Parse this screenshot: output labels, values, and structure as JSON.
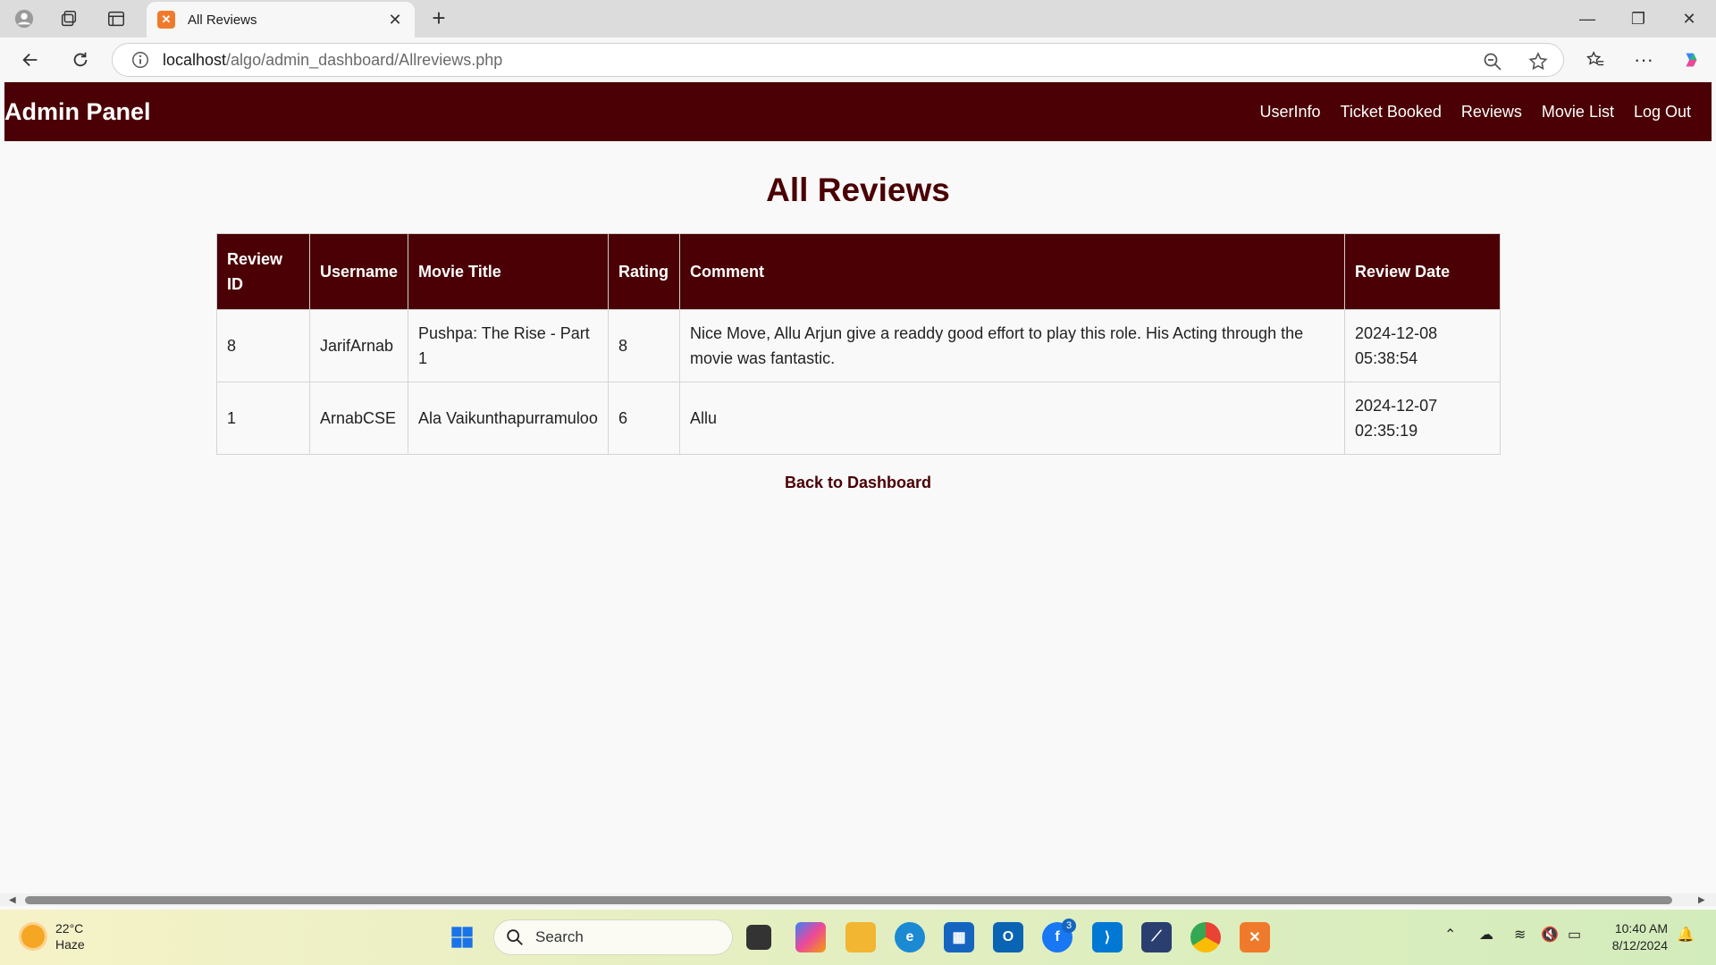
{
  "browser": {
    "tab_title": "All Reviews",
    "url_host": "localhost",
    "url_path": "/algo/admin_dashboard/Allreviews.php"
  },
  "navbar": {
    "brand": "Admin Panel",
    "links": [
      "UserInfo",
      "Ticket Booked",
      "Reviews",
      "Movie List",
      "Log Out"
    ]
  },
  "page": {
    "heading": "All Reviews",
    "back_link": "Back to Dashboard"
  },
  "table": {
    "headers": [
      "Review ID",
      "Username",
      "Movie Title",
      "Rating",
      "Comment",
      "Review Date"
    ],
    "rows": [
      [
        "8",
        "JarifArnab",
        "Pushpa: The Rise - Part 1",
        "8",
        "Nice Move, Allu Arjun give a readdy good effort to play this role. His Acting through the movie was fantastic.",
        "2024-12-08 05:38:54"
      ],
      [
        "1",
        "ArnabCSE",
        "Ala Vaikunthapurramuloo",
        "6",
        "Allu",
        "2024-12-07 02:35:19"
      ]
    ]
  },
  "taskbar": {
    "temperature": "22°C",
    "weather": "Haze",
    "search_placeholder": "Search",
    "notification_count": "3",
    "time": "10:40 AM",
    "date": "8/12/2024"
  },
  "colors": {
    "brand": "#4a0004"
  }
}
